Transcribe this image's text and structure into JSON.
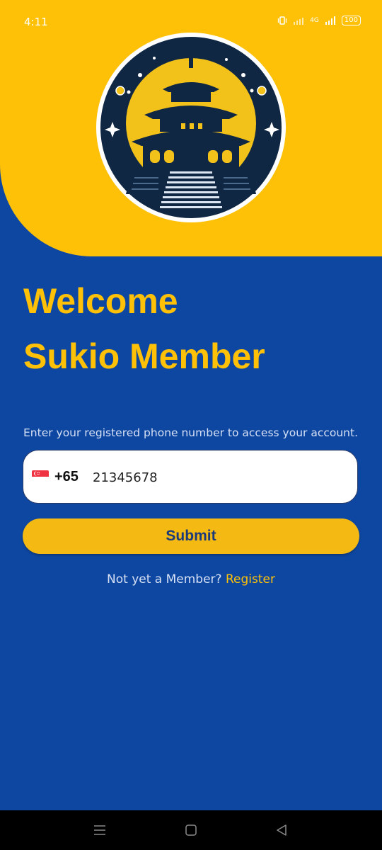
{
  "status_bar": {
    "time": "4:11",
    "network": "4G",
    "battery": "100"
  },
  "login": {
    "welcome_line1": "Welcome",
    "welcome_line2": "Sukio Member",
    "instruction": "Enter your registered phone number to access your account.",
    "country_code": "+65",
    "country_flag": "singapore-flag-icon",
    "phone_value": "21345678",
    "submit_label": "Submit",
    "register_prompt": "Not yet a Member?",
    "register_link": "Register"
  },
  "colors": {
    "primary_blue": "#0E47A1",
    "accent_yellow": "#FEC107",
    "button_yellow": "#F5B914",
    "button_text": "#1B3A7A"
  },
  "icons": {
    "logo": "temple-logo-icon",
    "nav_menu": "menu-icon",
    "nav_home": "home-square-icon",
    "nav_back": "back-triangle-icon"
  }
}
